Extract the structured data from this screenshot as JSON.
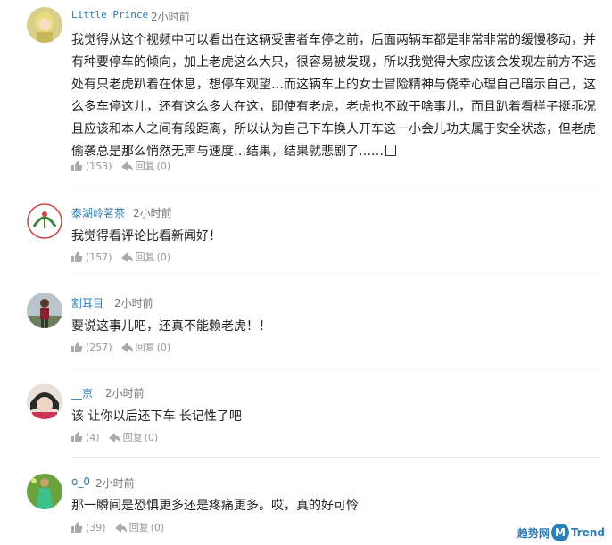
{
  "comments": [
    {
      "username": "Little Prince",
      "time": "2小时前",
      "text": "我觉得从这个视频中可以看出在这辆受害者车停之前，后面两辆车都是非常非常的缓慢移动，并有种要停车的倾向，加上老虎这么大只，很容易被发现，所以我觉得大家应该会发现左前方不远处有只老虎趴着在休息，想停车观望…而这辆车上的女士冒险精神与侥幸心理自己暗示自己，这么多车停这儿，还有这么多人在这，即使有老虎，老虎也不敢干啥事儿，而且趴着看样子挺乖况且应该和本人之间有段距离，所以认为自己下车换人开车这一小会儿功夫属于安全状态，但老虎偷袭总是那么悄然无声与速度…结果，结果就悲剧了……",
      "likes": "(153)",
      "reply_label": "回复",
      "reply_count": "(0)"
    },
    {
      "username": "泰湖岭茗茶",
      "time": "2小时前",
      "text": "我觉得看评论比看新闻好！",
      "likes": "(157)",
      "reply_label": "回复",
      "reply_count": "(0)"
    },
    {
      "username": "割耳目",
      "time": "2小时前",
      "text": "要说这事儿吧，还真不能赖老虎！！",
      "likes": "(257)",
      "reply_label": "回复",
      "reply_count": "(0)"
    },
    {
      "username": "__京",
      "time": "2小时前",
      "text": "该 让你以后还下车 长记性了吧",
      "likes": "(4)",
      "reply_label": "回复",
      "reply_count": "(0)"
    },
    {
      "username": "o_0",
      "time": "2小时前",
      "text": "那一瞬间是恐惧更多还是疼痛更多。哎，真的好可怜",
      "likes": "(39)",
      "reply_label": "回复",
      "reply_count": "(0)"
    }
  ],
  "watermark": {
    "left_text": "趋势网",
    "circle_letter": "M",
    "right_text": "Trend"
  },
  "colors": {
    "username": "#2a7ab0",
    "meta": "#999999",
    "divider": "#e6e6e6"
  },
  "icons": [
    "thumbs-up-icon",
    "reply-arrow-icon"
  ]
}
